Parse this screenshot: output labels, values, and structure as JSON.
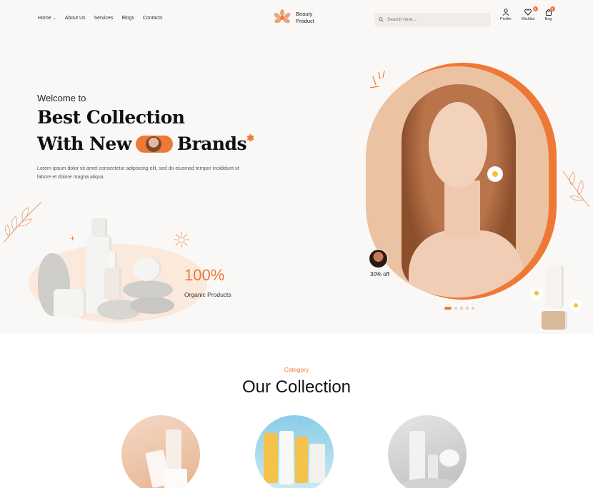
{
  "nav": {
    "menu": [
      {
        "label": "Home",
        "has_dropdown": true
      },
      {
        "label": "About Us"
      },
      {
        "label": "Services"
      },
      {
        "label": "Blogs"
      },
      {
        "label": "Contacts"
      }
    ],
    "logo_line1": "Beauty",
    "logo_line2": "Product",
    "search_placeholder": "Search here...",
    "icons": [
      {
        "label": "Profile",
        "icon": "user-icon"
      },
      {
        "label": "Wishlist",
        "icon": "heart-icon",
        "badge": "0"
      },
      {
        "label": "Bag",
        "icon": "bag-icon",
        "badge": "0"
      }
    ]
  },
  "hero": {
    "welcome": "Welcome to",
    "title_line1": "Best Collection",
    "title_line2_a": "With New",
    "title_line2_b": "Brands",
    "description": "Lorem ipsum dolor sit amet consectetur adipiscing elit, sed do eiusmod tempor incididunt ut labore et dolore magna aliqua.",
    "stat_value": "100%",
    "stat_label": "Organic Products",
    "discount": "30% off",
    "slider_dots": 5,
    "active_dot": 0
  },
  "collection": {
    "category_label": "Category",
    "title": "Our Collection"
  },
  "colors": {
    "accent": "#f07836",
    "hero_bg": "#faf8f6",
    "search_bg": "#f1ece8"
  }
}
